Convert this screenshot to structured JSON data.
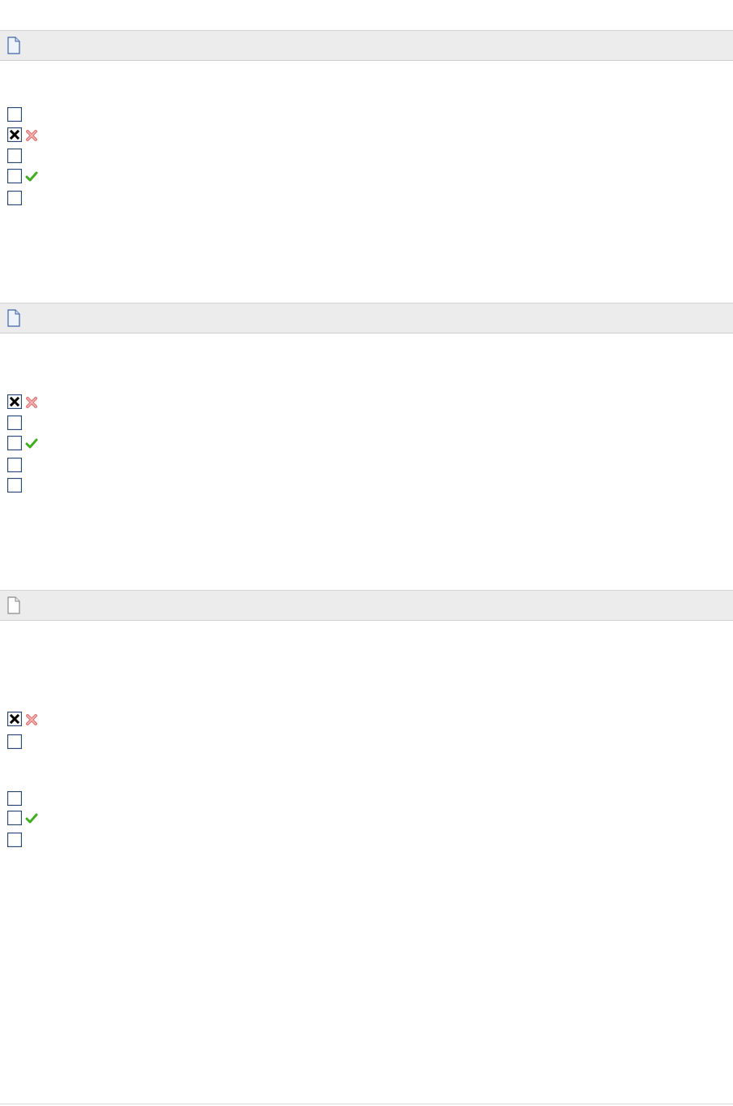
{
  "colors": {
    "header_bg": "#ececec",
    "checkbox_border": "#2a4a7a",
    "wrong_mark": "#d86a6a",
    "correct_mark": "#3fae1f"
  },
  "questions": [
    {
      "header_icon": "document-icon",
      "options": [
        {
          "checked": false,
          "mark": "none",
          "label": ""
        },
        {
          "checked": true,
          "mark": "wrong-icon",
          "label": ""
        },
        {
          "checked": false,
          "mark": "none",
          "label": ""
        },
        {
          "checked": false,
          "mark": "correct-icon",
          "label": ""
        },
        {
          "checked": false,
          "mark": "none",
          "label": ""
        }
      ]
    },
    {
      "header_icon": "document-icon",
      "options": [
        {
          "checked": true,
          "mark": "wrong-icon",
          "label": ""
        },
        {
          "checked": false,
          "mark": "none",
          "label": ""
        },
        {
          "checked": false,
          "mark": "correct-icon",
          "label": ""
        },
        {
          "checked": false,
          "mark": "none",
          "label": ""
        },
        {
          "checked": false,
          "mark": "none",
          "label": ""
        }
      ]
    },
    {
      "header_icon": "blank-document-icon",
      "options": [
        {
          "checked": true,
          "mark": "wrong-icon",
          "label": ""
        },
        {
          "checked": false,
          "mark": "none",
          "label": ""
        },
        {
          "checked": false,
          "mark": "none",
          "label": ""
        },
        {
          "checked": false,
          "mark": "correct-icon",
          "label": ""
        },
        {
          "checked": false,
          "mark": "none",
          "label": ""
        }
      ]
    }
  ]
}
